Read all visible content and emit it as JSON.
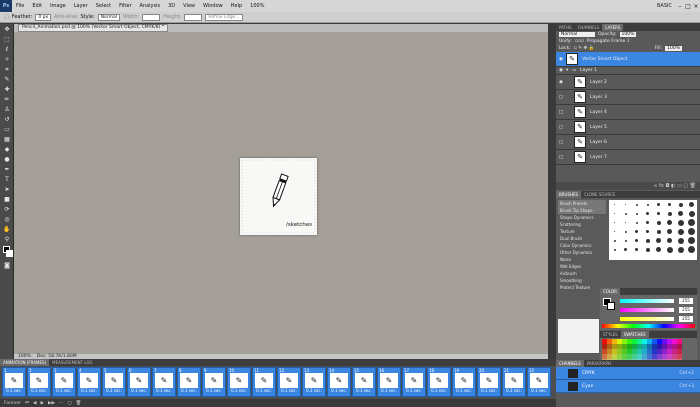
{
  "app": {
    "logo": "Ps",
    "zoom": "100%",
    "workspace": "BASIC"
  },
  "menu": [
    "File",
    "Edit",
    "Image",
    "Layer",
    "Select",
    "Filter",
    "Analysis",
    "3D",
    "View",
    "Window",
    "Help"
  ],
  "options": {
    "feather_label": "Feather:",
    "feather_value": "0 px",
    "antialias": "Anti-alias",
    "style_label": "Style:",
    "style_value": "Normal",
    "width_label": "Width:",
    "height_label": "Height:",
    "refine": "Refine Edge..."
  },
  "document": {
    "tab": "Pencil_Animation.psd @ 100% (Vector Smart Object, CMYK/8) *",
    "caption": "/sketches",
    "status": "100%",
    "doc_size": "Doc: 58.7K/1.80M"
  },
  "layers_panel": {
    "tabs": [
      "LAYERS",
      "CHANNELS",
      "PATHS"
    ],
    "blend_mode": "Normal",
    "opacity_label": "Opacity:",
    "opacity": "100%",
    "unify_label": "Unify:",
    "propagate": "Propagate Frame 1",
    "lock_label": "Lock:",
    "fill_label": "Fill:",
    "fill": "100%",
    "layers": [
      {
        "name": "Vector Smart Object",
        "selected": true,
        "visible": true
      },
      {
        "name": "Layer 1",
        "group": true,
        "visible": true
      },
      {
        "name": "Layer 2",
        "visible": true
      },
      {
        "name": "Layer 3",
        "visible": false
      },
      {
        "name": "Layer 4",
        "visible": false
      },
      {
        "name": "Layer 5",
        "visible": false
      },
      {
        "name": "Layer 6",
        "visible": false
      },
      {
        "name": "Layer 7",
        "visible": false
      }
    ]
  },
  "brushes": {
    "tabs": [
      "BRUSHES",
      "CLONE SOURCE"
    ],
    "items": [
      "Brush Presets",
      "Brush Tip Shape",
      "Shape Dynamics",
      "Scattering",
      "Texture",
      "Dual Brush",
      "Color Dynamics",
      "Other Dynamics",
      "Noise",
      "Wet Edges",
      "Airbrush",
      "Smoothing",
      "Protect Texture"
    ]
  },
  "color": {
    "tab": "COLOR",
    "r": "255",
    "g": "255",
    "b": "255"
  },
  "swatches": {
    "tabs": [
      "STYLES",
      "SWATCHES"
    ]
  },
  "channels": {
    "tabs": [
      "CHANNELS",
      "PARAGRAPH"
    ],
    "rows": [
      {
        "name": "CMYK",
        "shortcut": "Ctrl+2"
      },
      {
        "name": "Cyan",
        "shortcut": "Ctrl+3"
      }
    ]
  },
  "animation": {
    "tabs": [
      "ANIMATION (FRAMES)",
      "MEASUREMENT LOG"
    ],
    "loop": "Forever",
    "frames": [
      {
        "n": "1",
        "d": "0.1 sec."
      },
      {
        "n": "2",
        "d": "0.1 sec."
      },
      {
        "n": "3",
        "d": "0.1 sec."
      },
      {
        "n": "4",
        "d": "0.1 sec."
      },
      {
        "n": "5",
        "d": "0.1 sec."
      },
      {
        "n": "6",
        "d": "0.1 sec."
      },
      {
        "n": "7",
        "d": "0.1 sec."
      },
      {
        "n": "8",
        "d": "0.1 sec."
      },
      {
        "n": "9",
        "d": "0.1 sec."
      },
      {
        "n": "10",
        "d": "0.1 sec."
      },
      {
        "n": "11",
        "d": "0.1 sec."
      },
      {
        "n": "12",
        "d": "0.1 sec."
      },
      {
        "n": "13",
        "d": "0.1 sec."
      },
      {
        "n": "14",
        "d": "0.1 sec."
      },
      {
        "n": "15",
        "d": "0.1 sec."
      },
      {
        "n": "16",
        "d": "0.1 sec."
      },
      {
        "n": "17",
        "d": "0.1 sec."
      },
      {
        "n": "18",
        "d": "0.1 sec."
      },
      {
        "n": "19",
        "d": "0.1 sec."
      },
      {
        "n": "20",
        "d": "0.1 sec."
      },
      {
        "n": "21",
        "d": "0.1 sec."
      },
      {
        "n": "22",
        "d": "0.1 sec."
      }
    ]
  },
  "colors": {
    "accent": "#3b86e0",
    "canvas_bg": "#a59f99",
    "panel_bg": "#5a5a5a"
  }
}
